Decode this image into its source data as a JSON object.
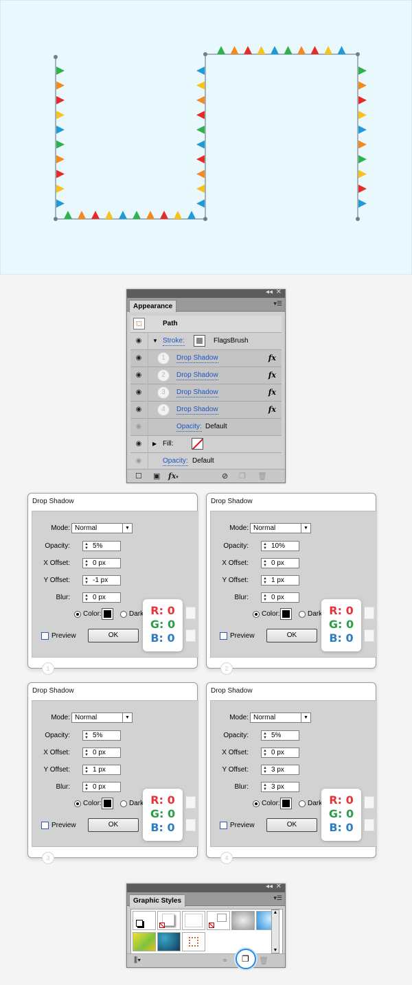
{
  "canvas": {
    "background": "#e8f8fd",
    "flag_colors": [
      "#2fb14d",
      "#f48a1f",
      "#e72b2b",
      "#f7c31a",
      "#1e9ad6"
    ]
  },
  "appearance": {
    "tab": "Appearance",
    "title": "Path",
    "stroke_label": "Stroke:",
    "stroke_value": "FlagsBrush",
    "effects": [
      {
        "num": "1",
        "label": "Drop Shadow",
        "fx": "fx"
      },
      {
        "num": "2",
        "label": "Drop Shadow",
        "fx": "fx"
      },
      {
        "num": "3",
        "label": "Drop Shadow",
        "fx": "fx"
      },
      {
        "num": "4",
        "label": "Drop Shadow",
        "fx": "fx"
      }
    ],
    "stroke_opacity_label": "Opacity:",
    "stroke_opacity_value": "Default",
    "fill_label": "Fill:",
    "opacity_label": "Opacity:",
    "opacity_value": "Default",
    "fx_menu": "fx"
  },
  "dialog_common": {
    "title": "Drop Shadow",
    "mode_label": "Mode:",
    "opacity_label": "Opacity:",
    "x_label": "X Offset:",
    "y_label": "Y Offset:",
    "blur_label": "Blur:",
    "color_label": "Color:",
    "dark_label": "Dark",
    "preview_label": "Preview",
    "ok_label": "OK",
    "r_label": "R: 0",
    "g_label": "G: 0",
    "b_label": "B: 0"
  },
  "dialogs": [
    {
      "badge": "1",
      "mode": "Normal",
      "opacity": "5%",
      "x": "0 px",
      "y": "-1 px",
      "blur": "0 px"
    },
    {
      "badge": "2",
      "mode": "Normal",
      "opacity": "10%",
      "x": "0 px",
      "y": "1 px",
      "blur": "0 px"
    },
    {
      "badge": "3",
      "mode": "Normal",
      "opacity": "5%",
      "x": "0 px",
      "y": "1 px",
      "blur": "0 px"
    },
    {
      "badge": "4",
      "mode": "Normal",
      "opacity": "5%",
      "x": "0 px",
      "y": "3 px",
      "blur": "3 px"
    }
  ],
  "graphic_styles": {
    "tab": "Graphic Styles"
  },
  "colors": {
    "r": "#e8333b",
    "g": "#2c9d4a",
    "b": "#2f7dc2",
    "link": "#1d55c4"
  }
}
